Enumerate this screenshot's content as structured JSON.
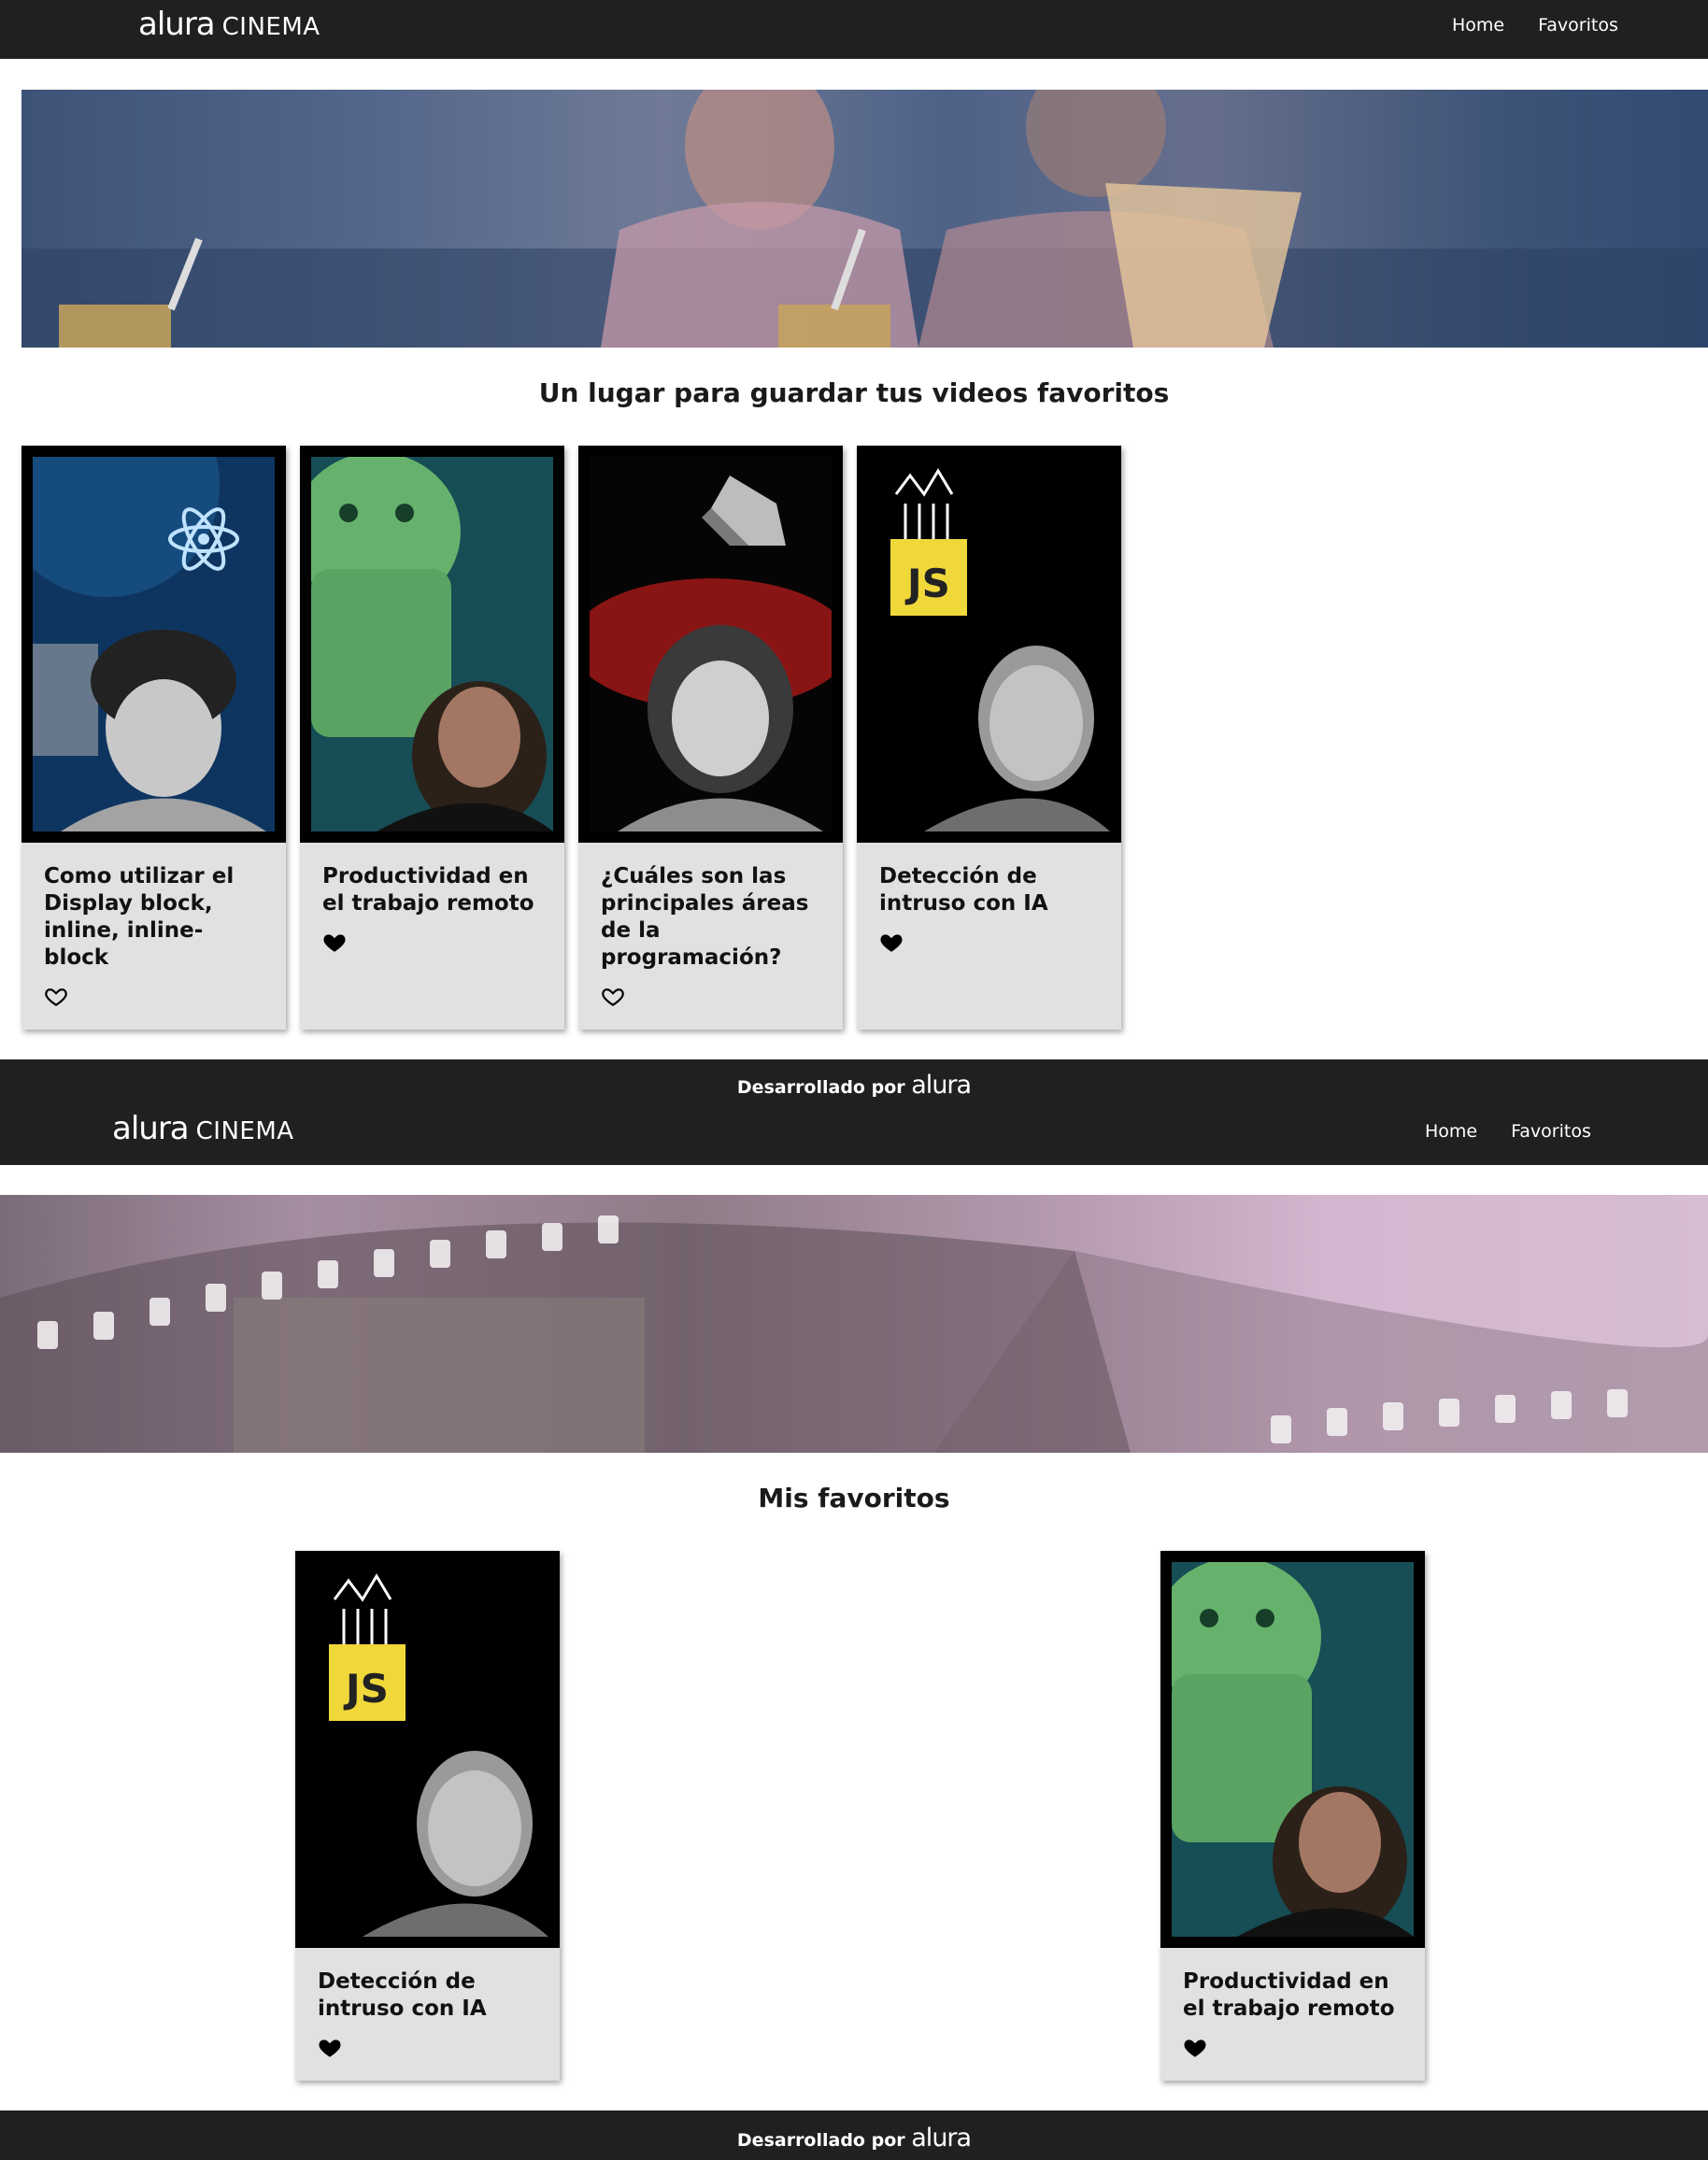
{
  "home": {
    "brand": {
      "alura": "alura",
      "cinema": "CINEMA"
    },
    "nav": {
      "home": "Home",
      "favorites": "Favoritos"
    },
    "section_title": "Un lugar para guardar tus videos favoritos",
    "cards": [
      {
        "title": "Como utilizar el Display block, inline, inline-block",
        "favorited": false,
        "theme": "react"
      },
      {
        "title": "Productividad en el trabajo remoto",
        "favorited": true,
        "theme": "android"
      },
      {
        "title": "¿Cuáles son las principales áreas de la programación?",
        "favorited": false,
        "theme": "dart"
      },
      {
        "title": "Detección de intruso con IA",
        "favorited": true,
        "theme": "js"
      }
    ],
    "footer": {
      "text": "Desarrollado por",
      "brand": "alura"
    }
  },
  "favorites": {
    "brand": {
      "alura": "alura",
      "cinema": "CINEMA"
    },
    "nav": {
      "home": "Home",
      "favorites": "Favoritos"
    },
    "section_title": "Mis favoritos",
    "cards": [
      {
        "title": "Detección de intruso con IA",
        "favorited": true,
        "theme": "js"
      },
      {
        "title": "Productividad en el trabajo remoto",
        "favorited": true,
        "theme": "android"
      }
    ],
    "footer": {
      "text": "Desarrollado por",
      "brand": "alura"
    }
  },
  "colors": {
    "header": "#202020",
    "card_bg": "#e1e1e1",
    "text": "#111111"
  }
}
